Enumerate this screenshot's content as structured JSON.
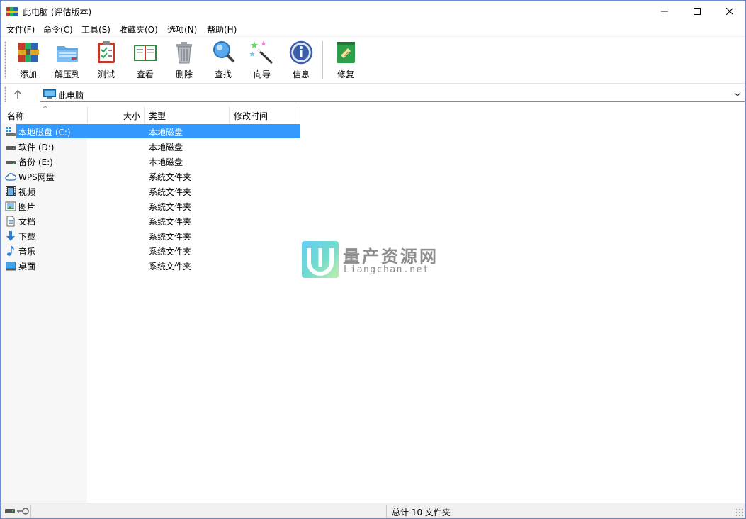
{
  "window": {
    "title": "此电脑 (评估版本)",
    "minimize_glyph": "—",
    "maximize_glyph": "☐",
    "close_glyph": "✕"
  },
  "menu": [
    {
      "label": "文件(F)"
    },
    {
      "label": "命令(C)"
    },
    {
      "label": "工具(S)"
    },
    {
      "label": "收藏夹(O)"
    },
    {
      "label": "选项(N)"
    },
    {
      "label": "帮助(H)"
    }
  ],
  "toolbar": [
    {
      "label": "添加",
      "icon": "add-archive-icon"
    },
    {
      "label": "解压到",
      "icon": "extract-folder-icon"
    },
    {
      "label": "测试",
      "icon": "test-clipboard-icon"
    },
    {
      "label": "查看",
      "icon": "view-book-icon"
    },
    {
      "label": "删除",
      "icon": "delete-trash-icon"
    },
    {
      "label": "查找",
      "icon": "find-magnifier-icon"
    },
    {
      "label": "向导",
      "icon": "wizard-wand-icon"
    },
    {
      "label": "信息",
      "icon": "info-icon"
    },
    {
      "label": "修复",
      "icon": "repair-kit-icon"
    }
  ],
  "address": {
    "path": "此电脑"
  },
  "columns": {
    "name": "名称",
    "size": "大小",
    "type": "类型",
    "modified": "修改时间"
  },
  "rows": [
    {
      "name": "本地磁盘 (C:)",
      "type": "本地磁盘",
      "icon": "system-drive-icon",
      "selected": true
    },
    {
      "name": "软件 (D:)",
      "type": "本地磁盘",
      "icon": "drive-icon"
    },
    {
      "name": "备份 (E:)",
      "type": "本地磁盘",
      "icon": "drive-icon"
    },
    {
      "name": "WPS网盘",
      "type": "系统文件夹",
      "icon": "cloud-icon"
    },
    {
      "name": "视频",
      "type": "系统文件夹",
      "icon": "video-icon"
    },
    {
      "name": "图片",
      "type": "系统文件夹",
      "icon": "picture-icon"
    },
    {
      "name": "文档",
      "type": "系统文件夹",
      "icon": "document-icon"
    },
    {
      "name": "下载",
      "type": "系统文件夹",
      "icon": "download-icon"
    },
    {
      "name": "音乐",
      "type": "系统文件夹",
      "icon": "music-icon"
    },
    {
      "name": "桌面",
      "type": "系统文件夹",
      "icon": "desktop-icon"
    }
  ],
  "watermark": {
    "title": "量产资源网",
    "subtitle": "Liangchan.net"
  },
  "status": {
    "text": "总计 10 文件夹"
  },
  "colors": {
    "selection": "#3399ff",
    "window_border": "#6a8ccd"
  }
}
